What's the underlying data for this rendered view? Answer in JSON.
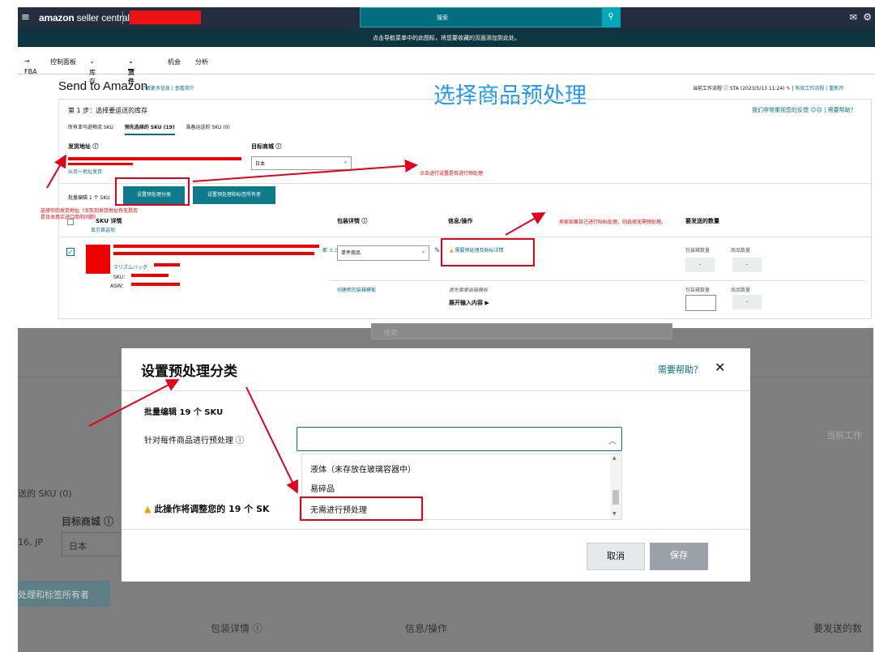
{
  "topbar": {
    "logo": "amazon",
    "logo_suffix": " seller central",
    "search_placeholder": "搜索"
  },
  "notice": "点击导航菜单中的此图标，将您要收藏的页面添加到此处。",
  "nav": {
    "crumb": "FBA",
    "items": [
      "控制面板",
      "库存",
      "货件",
      "机会",
      "分析"
    ]
  },
  "page": {
    "title": "Send to Amazon",
    "title_links": "了解更多信息 | 查看简介",
    "annotation_title": "选择商品预处理",
    "workflow_prefix": "当前工作流程 ",
    "workflow_value": "STA (2023/5/13 11:24)",
    "workflow_links": "有效工作流程 | 重新开",
    "step": "第 1 步：选择要运送的库存",
    "feedback": "我们非常重视您的反馈",
    "help": "需要帮助？",
    "tabs": [
      "所有亚马逊物流 SKU",
      "预先选择的 SKU (19)",
      "准备运送的 SKU (0)"
    ],
    "ship_from_label": "发货地址 ⓘ",
    "ship_from_alt": "从另一地址发货",
    "marketplace_label": "目标商城 ⓘ",
    "marketplace_value": "日本",
    "bulk_label": "批量编辑 1 个 SKU",
    "btn_prep": "设置预处理分类",
    "btn_prep_label": "设置预处理和标签所有者",
    "note_address": "选择你的发货地址（涉及到发货地址有无是否是日本真实进口商的问题）",
    "note_prep": "点击进行设置是否进行预处理",
    "note_sticker": "卖家如果自己进行贴标处理，则选择无需预处理。",
    "col_sku": "SKU 详情",
    "col_sku_sub": "显示首选项",
    "col_pack": "包装详情 ⓘ",
    "col_info": "信息/操作",
    "col_qty": "要发送的数量",
    "row_pack_value": "单件商品",
    "row_warning": "需要预处理及贴标详情",
    "row_sku_text": "マリズムバッグ",
    "row_sku_prefix": "SKU：",
    "row_asin_prefix": "ASIN：",
    "row_sku_side": "都 ミニ",
    "qty_box": "包装箱数量",
    "qty_items": "商品数量",
    "qty_dash": "-",
    "create_template": "创建新的装箱模板",
    "template_hint": "首先需要装箱模板",
    "expand": "展开输入内容 ▶"
  },
  "background": {
    "search": "搜索",
    "workflow": "当前工作",
    "sku_tab": "送的 SKU (0)",
    "marketplace_label": "目标商城 ⓘ",
    "marketplace_value": "日本",
    "jp": "16, JP",
    "btn": "处理和标签所有者",
    "col_pack": "包装详情 ⓘ",
    "col_info": "信息/操作",
    "col_qty": "要发送的数"
  },
  "modal": {
    "title": "设置预处理分类",
    "help": "需要帮助？",
    "bulk": "批量编辑 19 个 SKU",
    "prep_label": "针对每件商品进行预处理 ⓘ",
    "options": [
      "液体（未存放在玻璃容器中）",
      "易碎品",
      "无需进行预处理"
    ],
    "warning": "此操作将调整您的 19 个 SK",
    "cancel": "取消",
    "save": "保存"
  },
  "colors": {
    "nav_dark": "#232f3e",
    "teal": "#0e7a8a",
    "annotation_red": "#e0001b",
    "annotation_blue": "#2196f3"
  }
}
